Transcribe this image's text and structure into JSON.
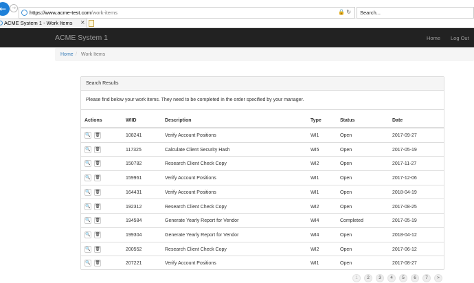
{
  "browser": {
    "url_host": "https://www.acme-test.com",
    "url_path": "/work-items",
    "search_placeholder": "Search...",
    "tab_title": "ACME System 1 - Work Items",
    "tab_close": "×",
    "back_icon": "←",
    "forward_icon": "→",
    "lock_icon": "🔒",
    "refresh_icon": "↻"
  },
  "navbar": {
    "brand": "ACME System 1",
    "home": "Home",
    "logout": "Log Out"
  },
  "breadcrumb": {
    "home": "Home",
    "separator": "/",
    "current": "Work Items"
  },
  "panel": {
    "heading": "Search Results",
    "description": "Please find below your work items. They need to be completed in the order specified by your manager."
  },
  "table": {
    "headers": {
      "actions": "Actions",
      "wiid": "WIID",
      "description": "Description",
      "type": "Type",
      "status": "Status",
      "date": "Date"
    },
    "rows": [
      {
        "wiid": "108241",
        "description": "Verify Account Positions",
        "type": "WI1",
        "status": "Open",
        "date": "2017-09-27"
      },
      {
        "wiid": "117325",
        "description": "Calculate Client Security Hash",
        "type": "WI5",
        "status": "Open",
        "date": "2017-05-19"
      },
      {
        "wiid": "150782",
        "description": "Research Client Check Copy",
        "type": "WI2",
        "status": "Open",
        "date": "2017-11-27"
      },
      {
        "wiid": "159961",
        "description": "Verify Account Positions",
        "type": "WI1",
        "status": "Open",
        "date": "2017-12-06"
      },
      {
        "wiid": "164431",
        "description": "Verify Account Positions",
        "type": "WI1",
        "status": "Open",
        "date": "2018-04-19"
      },
      {
        "wiid": "192312",
        "description": "Research Client Check Copy",
        "type": "WI2",
        "status": "Open",
        "date": "2017-08-25"
      },
      {
        "wiid": "194584",
        "description": "Generate Yearly Report for Vendor",
        "type": "WI4",
        "status": "Completed",
        "date": "2017-05-19"
      },
      {
        "wiid": "199304",
        "description": "Generate Yearly Report for Vendor",
        "type": "WI4",
        "status": "Open",
        "date": "2018-04-12"
      },
      {
        "wiid": "200552",
        "description": "Research Client Check Copy",
        "type": "WI2",
        "status": "Open",
        "date": "2017-06-12"
      },
      {
        "wiid": "207221",
        "description": "Verify Account Positions",
        "type": "WI1",
        "status": "Open",
        "date": "2017-08-27"
      }
    ],
    "view_icon": "🔍",
    "delete_icon": "🗑"
  },
  "pagination": [
    "1",
    "2",
    "3",
    "4",
    "5",
    "6",
    "7",
    ">"
  ]
}
